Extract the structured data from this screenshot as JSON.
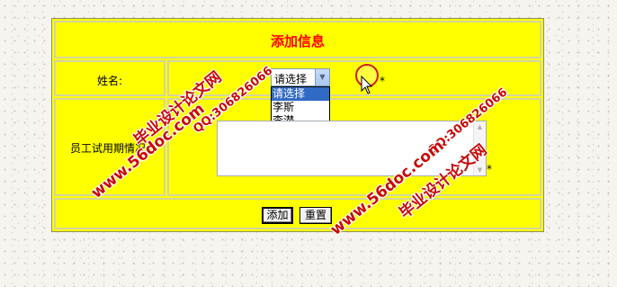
{
  "form": {
    "title": "添加信息",
    "name_label": "姓名:",
    "evaluation_label": "员工试用期情况:",
    "required_mark": "*"
  },
  "name_select": {
    "selected": "请选择",
    "options": [
      "请选择",
      "李斯",
      "李潜"
    ]
  },
  "buttons": {
    "add": "添加",
    "reset": "重置"
  },
  "watermarks": {
    "site": "www.56doc.com",
    "qq": "QQ:306826066",
    "name": "毕业设计论文网"
  },
  "icons": {
    "dropdown_arrow": "chevron-down-icon",
    "cursor": "mouse-pointer-icon"
  },
  "colors": {
    "form_bg": "#ffff00",
    "title": "#ff0000",
    "watermark": "#c60a0a",
    "selected_option_bg": "#316ac5"
  }
}
